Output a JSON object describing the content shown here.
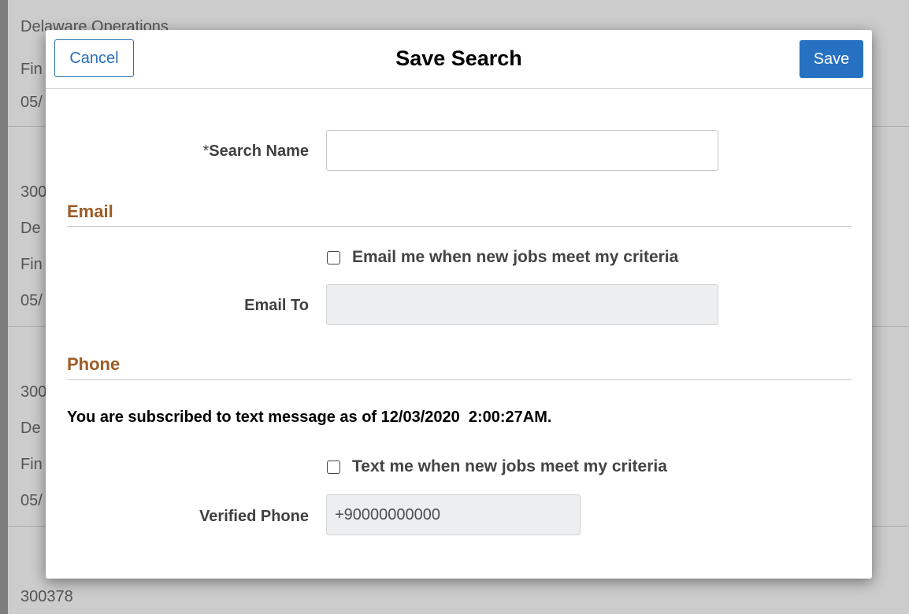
{
  "background": {
    "lines": [
      "Delaware Operations",
      "Fin",
      "05/",
      "300",
      "De",
      "Fin",
      "05/",
      "300",
      "De",
      "Fin",
      "05/",
      "300378"
    ]
  },
  "modal": {
    "title": "Save Search",
    "cancel_label": "Cancel",
    "save_label": "Save",
    "search_name": {
      "required_marker": "*",
      "label": "Search Name",
      "value": ""
    },
    "email_section": {
      "title": "Email",
      "checkbox_label": "Email me when new jobs meet my criteria",
      "checked": false,
      "email_to_label": "Email To",
      "email_to_value": ""
    },
    "phone_section": {
      "title": "Phone",
      "subscription_message": "You are subscribed to text message as of 12/03/2020  2:00:27AM.",
      "checkbox_label": "Text me when new jobs meet my criteria",
      "checked": false,
      "verified_phone_label": "Verified Phone",
      "verified_phone_value": "+90000000000"
    }
  },
  "colors": {
    "accent_blue": "#2671c2",
    "section_title": "#9e5c25",
    "overlay": "#7d7d7d"
  }
}
